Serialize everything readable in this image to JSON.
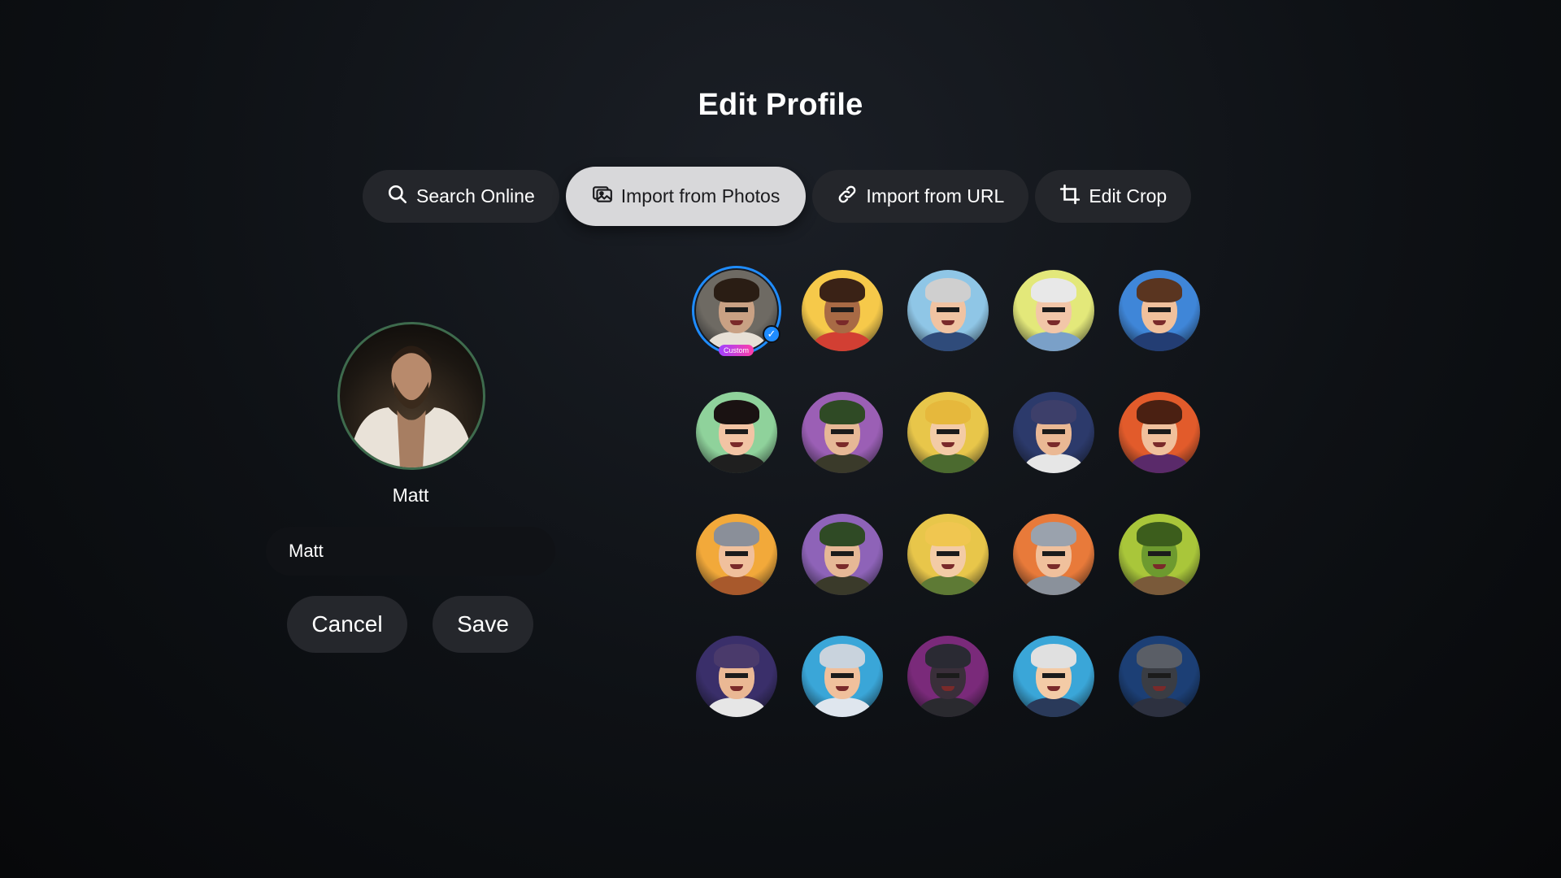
{
  "page": {
    "title": "Edit Profile"
  },
  "tabs": [
    {
      "label": "Search Online",
      "icon": "search-icon",
      "active": false
    },
    {
      "label": "Import from Photos",
      "icon": "photos-icon",
      "active": true
    },
    {
      "label": "Import from URL",
      "icon": "link-icon",
      "active": false
    },
    {
      "label": "Edit Crop",
      "icon": "crop-icon",
      "active": false
    }
  ],
  "profile": {
    "display_name": "Matt",
    "name_field_value": "Matt",
    "cancel_label": "Cancel",
    "save_label": "Save"
  },
  "avatars": {
    "custom_tag": "Custom",
    "selected_index": 0,
    "items": [
      {
        "name": "custom-photo",
        "bg": "#6e6a63",
        "skin": "#c9a184",
        "hair": "#2a1d14",
        "body": "#e7e0d6"
      },
      {
        "name": "curly-kid",
        "bg": "#f6c94a",
        "skin": "#a86a45",
        "hair": "#3a2216",
        "body": "#d23f33"
      },
      {
        "name": "bald-glasses-man",
        "bg": "#8fc6e6",
        "skin": "#f0c3a2",
        "hair": "#cfcfcf",
        "body": "#2f4b7a"
      },
      {
        "name": "grandma",
        "bg": "#e3e87a",
        "skin": "#f2c6a8",
        "hair": "#e8e8e8",
        "body": "#7aa0c8"
      },
      {
        "name": "young-man",
        "bg": "#3f86d8",
        "skin": "#f0c09c",
        "hair": "#5a3520",
        "body": "#233d73"
      },
      {
        "name": "dark-hair-woman",
        "bg": "#8fd29b",
        "skin": "#f2c4a4",
        "hair": "#1a1212",
        "body": "#1f1f1f"
      },
      {
        "name": "hooded-ranger",
        "bg": "#9b5fb5",
        "skin": "#e6b896",
        "hair": "#2f4a25",
        "body": "#3a3a2a"
      },
      {
        "name": "blonde-elf",
        "bg": "#e8c64a",
        "skin": "#f3cba6",
        "hair": "#e6b83c",
        "body": "#4b6a2f"
      },
      {
        "name": "wizard-blue",
        "bg": "#2c3a6b",
        "skin": "#eab894",
        "hair": "#3d3f6a",
        "body": "#e6e6e6"
      },
      {
        "name": "fire-mage",
        "bg": "#e25b2b",
        "skin": "#f0c09c",
        "hair": "#4a2012",
        "body": "#5a2a6a"
      },
      {
        "name": "dwarf-warrior",
        "bg": "#f2a93a",
        "skin": "#f0c09c",
        "hair": "#8a8f99",
        "body": "#a8592c"
      },
      {
        "name": "green-hood-archer",
        "bg": "#8e63b8",
        "skin": "#e6b896",
        "hair": "#2f4a25",
        "body": "#3a3a2a"
      },
      {
        "name": "elf-princess",
        "bg": "#e8c64a",
        "skin": "#f3cba6",
        "hair": "#f0c650",
        "body": "#5e7a35"
      },
      {
        "name": "armored-knight",
        "bg": "#e87a3a",
        "skin": "#f0c09c",
        "hair": "#9aa2ad",
        "body": "#8a919b"
      },
      {
        "name": "orc",
        "bg": "#a9c63a",
        "skin": "#6d9a2f",
        "hair": "#3c5d1c",
        "body": "#7a5a3a"
      },
      {
        "name": "old-wizard",
        "bg": "#3a2f6a",
        "skin": "#eab894",
        "hair": "#4a3a6b",
        "body": "#e6e6e6"
      },
      {
        "name": "space-pilot",
        "bg": "#3aa6d8",
        "skin": "#f0c09c",
        "hair": "#c9d3dd",
        "body": "#dfe6ee"
      },
      {
        "name": "cyborg-visor",
        "bg": "#7a2a7a",
        "skin": "#3a2f3a",
        "hair": "#2a2a33",
        "body": "#2a2a2f"
      },
      {
        "name": "silver-hair-elf",
        "bg": "#3aa6d8",
        "skin": "#f3cba6",
        "hair": "#e0e0e0",
        "body": "#2a3a5a"
      },
      {
        "name": "helmet-bounty-hunter",
        "bg": "#1c3f75",
        "skin": "#3a3d44",
        "hair": "#5a5e66",
        "body": "#2d3140"
      }
    ]
  }
}
